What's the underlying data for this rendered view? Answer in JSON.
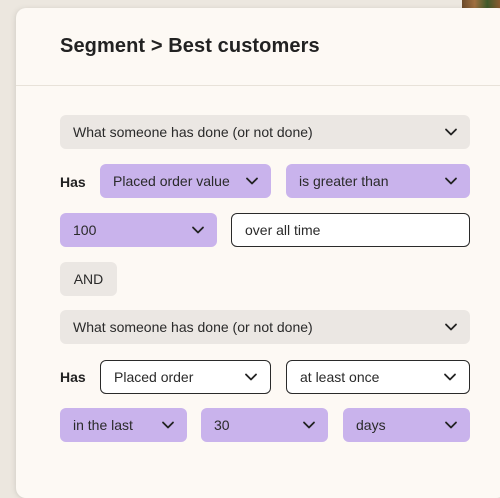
{
  "title": "Segment > Best customers",
  "groups": [
    {
      "type_select": "What someone has done (or not done)",
      "has_label": "Has",
      "metric": "Placed order value",
      "operator": "is greater than",
      "value": "100",
      "timeframe_input": "over all time"
    },
    {
      "type_select": "What someone has done (or not done)",
      "has_label": "Has",
      "metric": "Placed order",
      "operator": "at least once",
      "time_qualifier": "in the last",
      "amount": "30",
      "unit": "days"
    }
  ],
  "connector": "AND"
}
